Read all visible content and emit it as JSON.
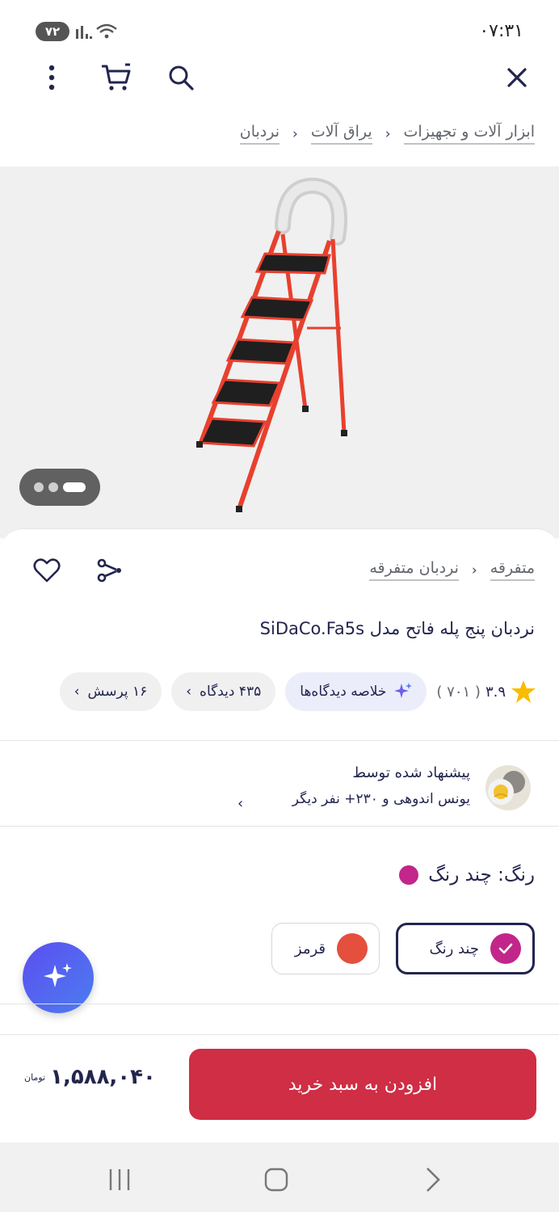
{
  "status_bar": {
    "time": "۰۷:۳۱",
    "battery": "۷۲"
  },
  "breadcrumb": [
    "ابزار آلات و تجهیزات",
    "یراق آلات",
    "نردبان"
  ],
  "category_breadcrumb": [
    "متفرقه",
    "نردبان متفرقه"
  ],
  "product": {
    "title": "نردبان پنج پله فاتح مدل SiDaCo.Fa5s"
  },
  "rating": {
    "score": "۳.۹",
    "count": "( ۷۰۱ )"
  },
  "chips": {
    "ai_summary": "خلاصه دیدگاه‌ها",
    "reviews": "۴۳۵ دیدگاه",
    "questions": "۱۶ پرسش"
  },
  "recommendation": {
    "title": "پیشنهاد شده توسط",
    "by": "یونس اندوهی و ۲۳۰+ نفر دیگر"
  },
  "color": {
    "label": "رنگ: چند رنگ",
    "options": [
      {
        "name": "چند رنگ",
        "color": "#c2268a",
        "selected": true
      },
      {
        "name": "قرمز",
        "color": "#e4503d",
        "selected": false
      }
    ]
  },
  "buy": {
    "button": "افزودن به سبد خرید",
    "price": "۱,۵۸۸,۰۴۰",
    "currency": "تومان"
  }
}
